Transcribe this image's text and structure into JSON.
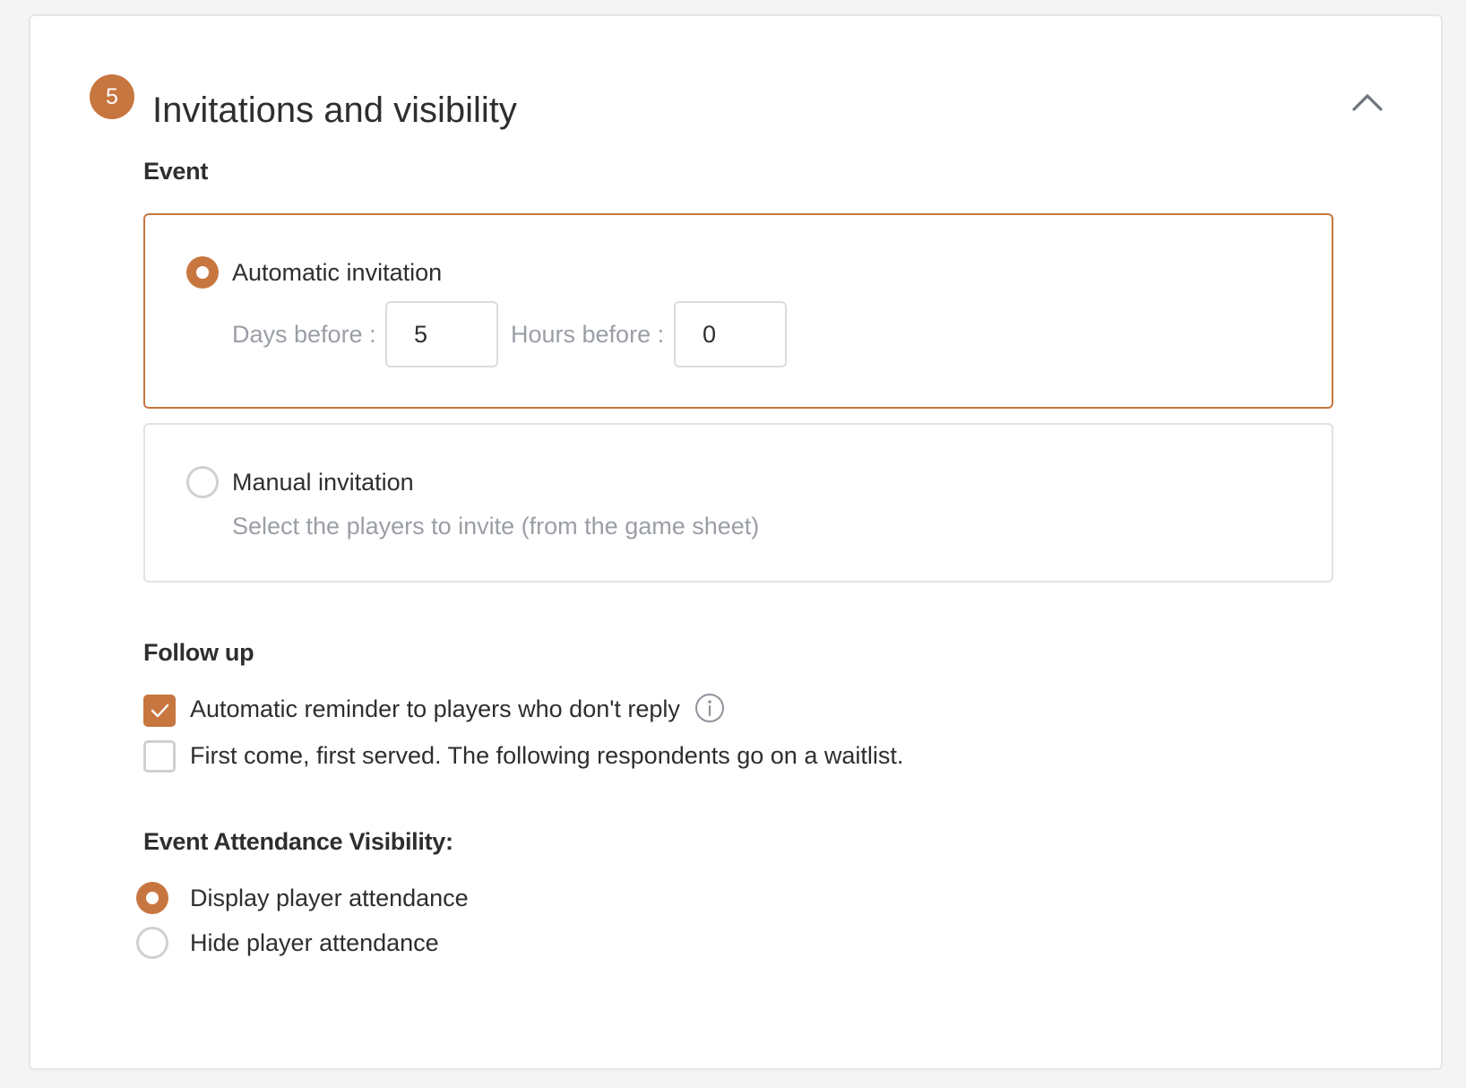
{
  "section": {
    "step_number": "5",
    "title": "Invitations and visibility"
  },
  "event": {
    "heading": "Event",
    "automatic": {
      "label": "Automatic invitation",
      "selected": true,
      "days_label": "Days before :",
      "days_value": "5",
      "hours_label": "Hours before :",
      "hours_value": "0"
    },
    "manual": {
      "label": "Manual invitation",
      "selected": false,
      "description": "Select the players to invite (from the game sheet)"
    }
  },
  "follow_up": {
    "heading": "Follow up",
    "options": [
      {
        "label": "Automatic reminder to players who don't reply",
        "checked": true,
        "has_info": true
      },
      {
        "label": "First come, first served. The following respondents go on a waitlist.",
        "checked": false
      }
    ]
  },
  "attendance_visibility": {
    "heading": "Event Attendance Visibility:",
    "options": [
      {
        "label": "Display player attendance",
        "selected": true
      },
      {
        "label": "Hide player attendance",
        "selected": false
      }
    ]
  },
  "colors": {
    "accent": "#c8763f",
    "border": "#e2e2e2",
    "muted_text": "#9a9ea5",
    "text": "#2e2e2e",
    "background": "#f4f4f4"
  },
  "icons": {
    "collapse": "chevron-up-icon",
    "info": "info-icon",
    "check": "check-icon"
  }
}
